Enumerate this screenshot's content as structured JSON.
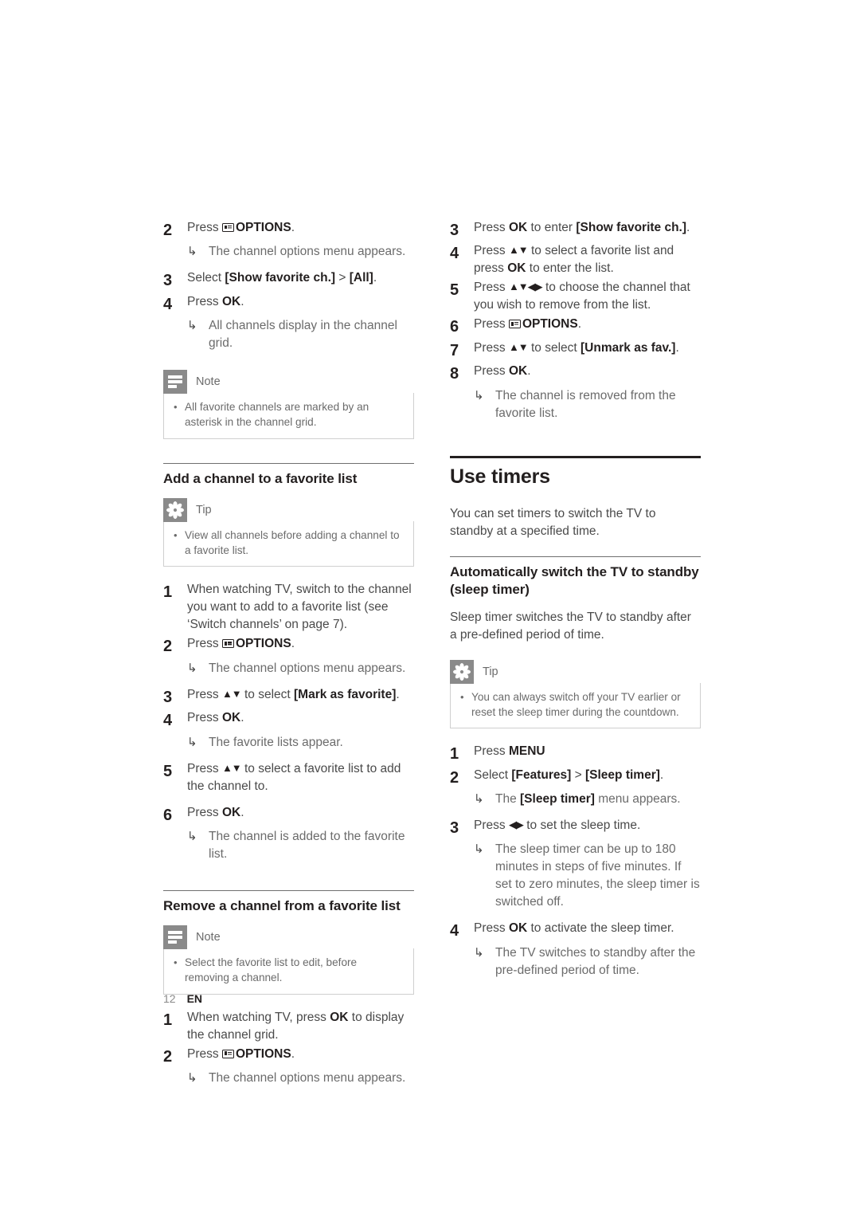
{
  "page": {
    "number": "12",
    "language": "EN"
  },
  "icons": {
    "note": "note-icon",
    "tip": "tip-icon",
    "options": "options-remote-icon",
    "result_arrow": "↳",
    "bullet": "•"
  },
  "left_column": {
    "continued_steps": [
      {
        "num": "2",
        "text_before_icon": "Press ",
        "keyword": "OPTIONS",
        "text_after": ".",
        "result": "The channel options menu appears."
      },
      {
        "num": "3",
        "text_before": "Select ",
        "keyword": "[Show favorite ch.]",
        "text_middle": " > ",
        "keyword2": "[All]",
        "text_after": "."
      },
      {
        "num": "4",
        "text_before": "Press ",
        "keyword": "OK",
        "text_after": ".",
        "result": "All channels display in the channel grid."
      }
    ],
    "note_1": {
      "title": "Note",
      "bullets": [
        "All favorite channels are marked by an asterisk in the channel grid."
      ]
    },
    "section_add": {
      "heading": "Add a channel to a favorite list",
      "tip": {
        "title": "Tip",
        "bullets": [
          "View all channels before adding a channel to a favorite list."
        ]
      },
      "steps": [
        {
          "num": "1",
          "text": "When watching TV, switch to the channel you want to add to a favorite list (see ‘Switch channels’ on page 7)."
        },
        {
          "num": "2",
          "text_before": "Press ",
          "keyword": "OPTIONS",
          "text_after": ".",
          "result": "The channel options menu appears."
        },
        {
          "num": "3",
          "text_before": "Press ",
          "navkeys": "▲▼",
          "text_middle": " to select ",
          "keyword": "[Mark as favorite]",
          "text_after": "."
        },
        {
          "num": "4",
          "text_before": "Press ",
          "keyword": "OK",
          "text_after": ".",
          "result": "The favorite lists appear."
        },
        {
          "num": "5",
          "text_before": "Press ",
          "navkeys": "▲▼",
          "text_middle": " to select a favorite list to add the channel to."
        },
        {
          "num": "6",
          "text_before": "Press ",
          "keyword": "OK",
          "text_after": ".",
          "result": "The channel is added to the favorite list."
        }
      ]
    },
    "section_remove": {
      "heading": "Remove a channel from a favorite list",
      "note": {
        "title": "Note",
        "bullets": [
          "Select the favorite list to edit, before removing a channel."
        ]
      },
      "steps": [
        {
          "num": "1",
          "text_before": "When watching TV, press ",
          "keyword": "OK",
          "text_after": " to display the channel grid."
        },
        {
          "num": "2",
          "text_before": "Press ",
          "keyword": "OPTIONS",
          "text_after": ".",
          "result": "The channel options menu appears."
        }
      ]
    }
  },
  "right_column": {
    "continued_steps": [
      {
        "num": "3",
        "text_before": "Press ",
        "keyword": "OK",
        "text_middle": " to enter ",
        "keyword2": "[Show favorite ch.]",
        "text_after": "."
      },
      {
        "num": "4",
        "text_before": "Press ",
        "navkeys": "▲▼",
        "text_middle": " to select a favorite list and press ",
        "keyword": "OK",
        "text_after": " to enter the list."
      },
      {
        "num": "5",
        "text_before": "Press ",
        "navkeys": "▲▼◀▶",
        "text_middle": " to choose the channel that you wish to remove from the list."
      },
      {
        "num": "6",
        "text_before": "Press ",
        "keyword": "OPTIONS",
        "text_after": "."
      },
      {
        "num": "7",
        "text_before": "Press ",
        "navkeys": "▲▼",
        "text_middle": " to select ",
        "keyword": "[Unmark as fav.]",
        "text_after": "."
      },
      {
        "num": "8",
        "text_before": "Press ",
        "keyword": "OK",
        "text_after": ".",
        "result": "The channel is removed from the favorite list."
      }
    ],
    "section_timers": {
      "heading": "Use timers",
      "intro": "You can set timers to switch the TV to standby at a specified time.",
      "subheading": "Automatically switch the TV to standby (sleep timer)",
      "sub_intro": "Sleep timer switches the TV to standby after a pre-defined period of time.",
      "tip": {
        "title": "Tip",
        "bullets": [
          "You can always switch off your TV earlier or reset the sleep timer during the countdown."
        ]
      },
      "steps": [
        {
          "num": "1",
          "text_before": "Press ",
          "keyword": "MENU"
        },
        {
          "num": "2",
          "text_before": "Select ",
          "keyword": "[Features]",
          "text_middle": " > ",
          "keyword2": "[Sleep timer]",
          "text_after": ".",
          "result_before": "The ",
          "result_keyword": "[Sleep timer]",
          "result_after": " menu appears."
        },
        {
          "num": "3",
          "text_before": "Press ",
          "navkeys": "◀▶",
          "text_middle": " to set the sleep time.",
          "result": "The sleep timer can be up to 180 minutes in steps of five minutes. If set to zero minutes, the sleep timer is switched off."
        },
        {
          "num": "4",
          "text_before": "Press ",
          "keyword": "OK",
          "text_after": " to activate the sleep timer.",
          "result": "The TV switches to standby after the pre-defined period of time."
        }
      ]
    }
  }
}
